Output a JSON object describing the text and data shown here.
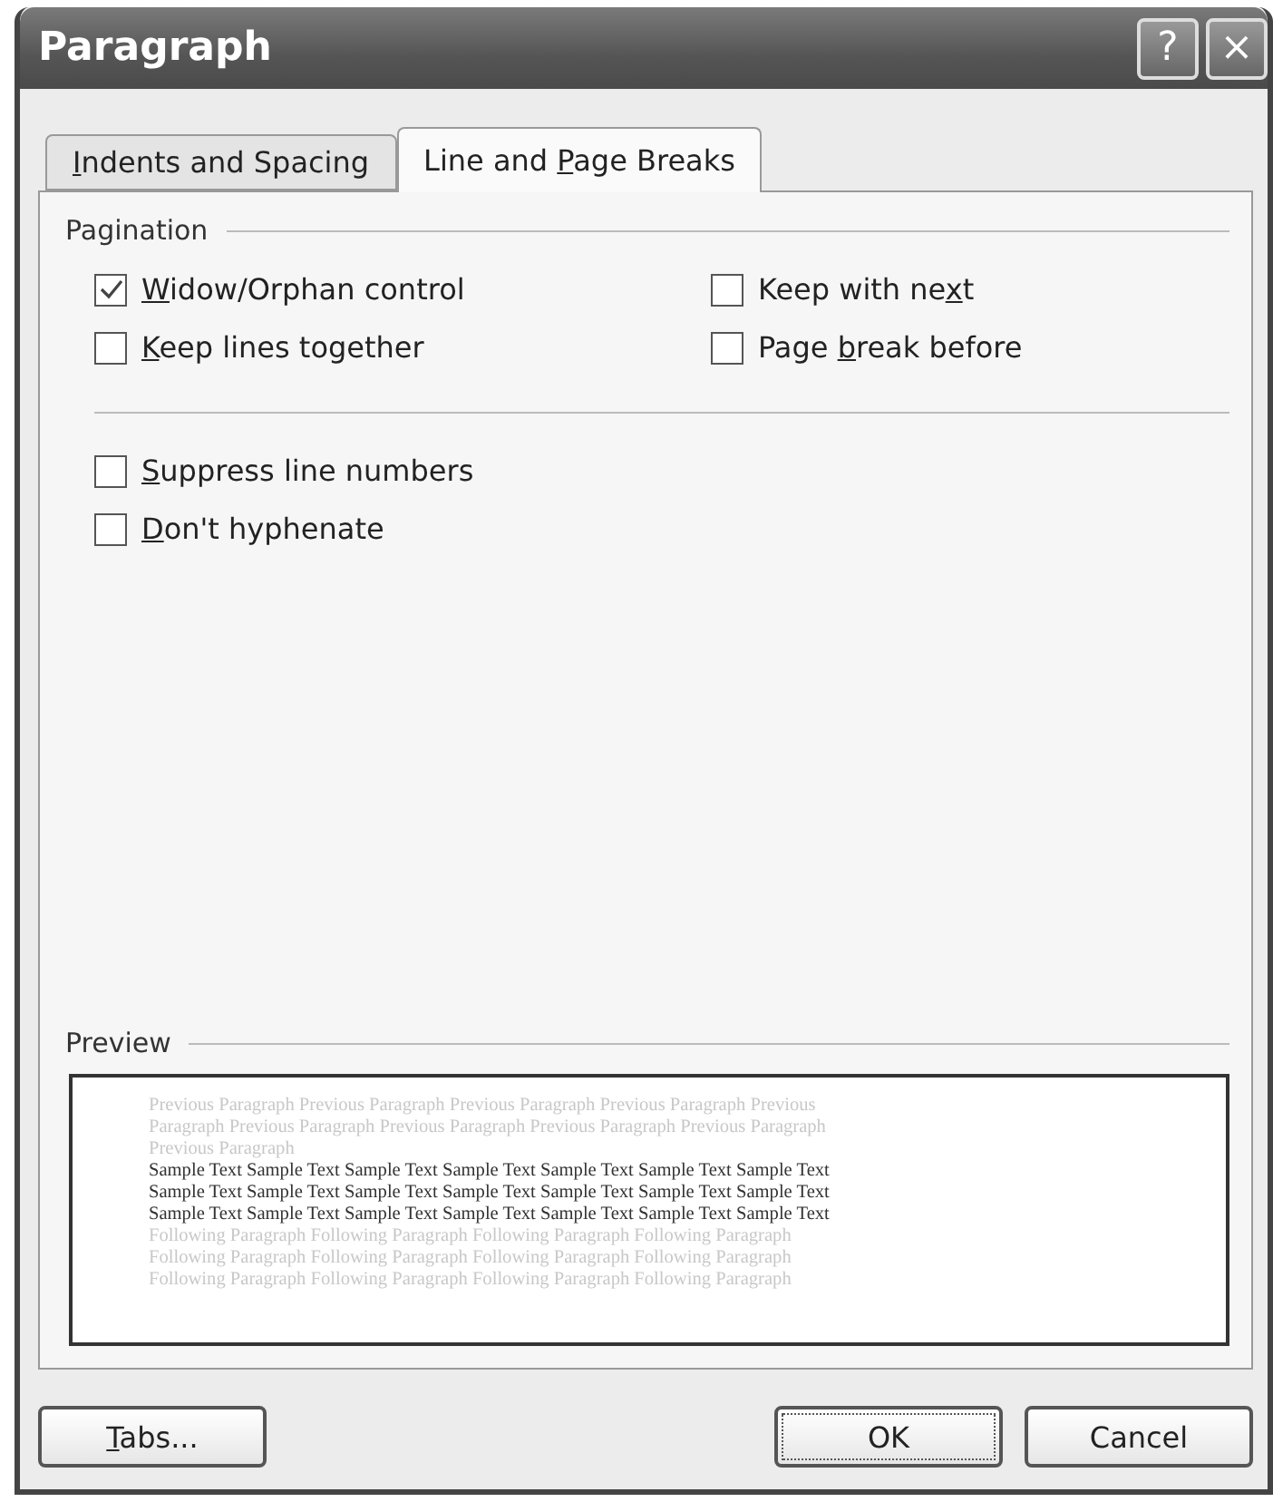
{
  "window": {
    "title": "Paragraph",
    "title_buttons": [
      "?",
      "×"
    ]
  },
  "tabs": [
    {
      "label": {
        "key": "I",
        "after": "ndents and Spacing"
      },
      "selected": false
    },
    {
      "label": {
        "before": "Line and ",
        "key": "P",
        "after": "age Breaks"
      },
      "selected": true
    }
  ],
  "pagination": {
    "heading": "Pagination",
    "options": [
      {
        "label": {
          "key": "W",
          "after": "idow/Orphan control"
        },
        "checked": true
      },
      {
        "label": {
          "before": "Keep with ne",
          "key": "x",
          "after": "t"
        },
        "checked": false
      },
      {
        "label": {
          "key": "K",
          "after": "eep lines together"
        },
        "checked": false
      },
      {
        "label": {
          "before": "Page ",
          "key": "b",
          "after": "reak before"
        },
        "checked": false
      }
    ]
  },
  "other_options": [
    {
      "label": {
        "key": "S",
        "after": "uppress line numbers"
      },
      "checked": false
    },
    {
      "label": {
        "key": "D",
        "after": "on't hyphenate"
      },
      "checked": false
    }
  ],
  "preview": {
    "heading": "Preview",
    "lines": [
      {
        "kind": "other",
        "text": "Previous Paragraph Previous Paragraph Previous Paragraph Previous Paragraph Previous"
      },
      {
        "kind": "other",
        "text": "Paragraph Previous Paragraph Previous Paragraph Previous Paragraph Previous Paragraph"
      },
      {
        "kind": "other",
        "text": "Previous Paragraph"
      },
      {
        "kind": "sample",
        "text": "Sample Text Sample Text Sample Text Sample Text Sample Text Sample Text Sample Text"
      },
      {
        "kind": "sample",
        "text": "Sample Text Sample Text Sample Text Sample Text Sample Text Sample Text Sample Text"
      },
      {
        "kind": "sample",
        "text": "Sample Text Sample Text Sample Text Sample Text Sample Text Sample Text Sample Text"
      },
      {
        "kind": "other",
        "text": "Following Paragraph Following Paragraph Following Paragraph Following Paragraph"
      },
      {
        "kind": "other",
        "text": "Following Paragraph Following Paragraph Following Paragraph Following Paragraph"
      },
      {
        "kind": "other",
        "text": "Following Paragraph Following Paragraph Following Paragraph Following Paragraph"
      }
    ]
  },
  "buttons": [
    {
      "label": {
        "key": "T",
        "after": "abs..."
      },
      "kind": "left"
    },
    {
      "label": {
        "before": "OK"
      },
      "kind": "default"
    },
    {
      "label": {
        "before": "Cancel"
      },
      "kind": "normal"
    }
  ]
}
